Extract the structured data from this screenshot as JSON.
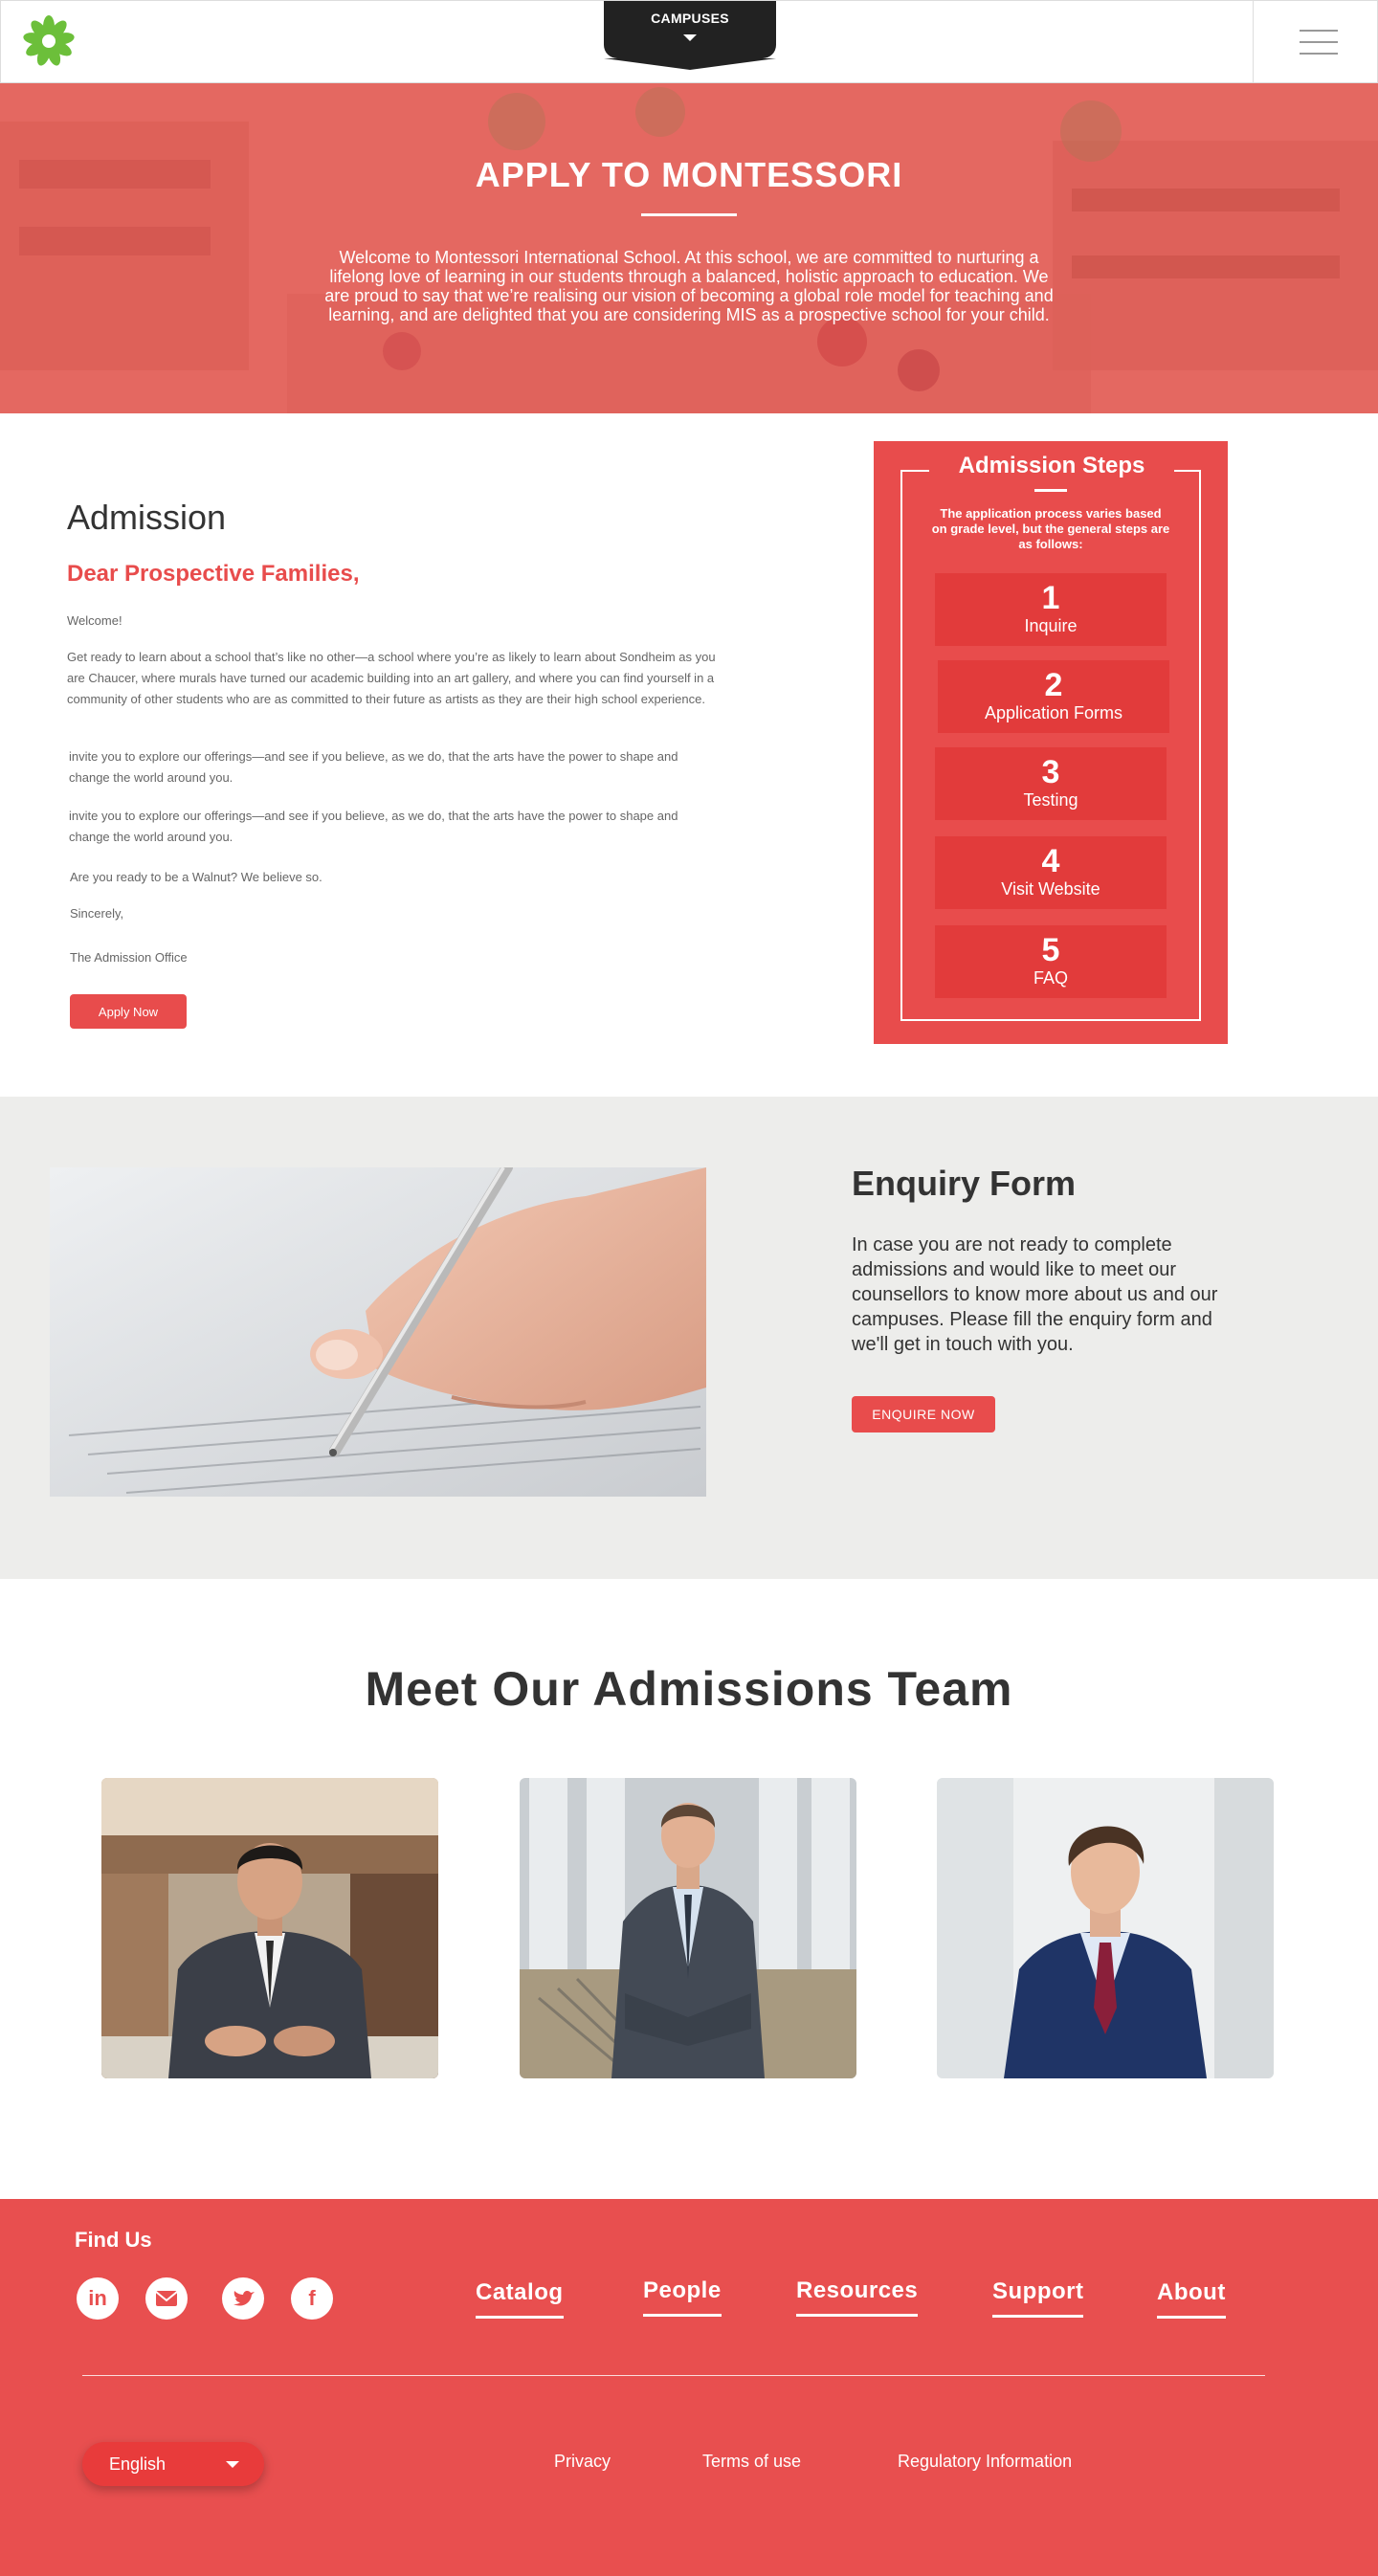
{
  "header": {
    "campus_label": "CAMPUSES",
    "logo_icon": "flower-logo-icon",
    "menu_icon": "hamburger-menu-icon"
  },
  "hero": {
    "title": "APPLY TO MONTESSORI",
    "text": "Welcome to Montessori International School. At this school, we are committed to nurturing a lifelong love of learning in our students through a balanced, holistic approach to education. We are proud to say that we’re realising our vision of becoming a global role model for teaching and learning, and are delighted that you are considering MIS as a prospective school for your child."
  },
  "admission": {
    "heading": "Admission",
    "greeting": "Dear Prospective Families,",
    "welcome": "Welcome!",
    "p1": "Get ready to learn about a school that’s like no other—a school where you’re as likely to learn about Sondheim as you are Chaucer, where murals have turned our academic building into an art gallery, and where you can find yourself in a community of other students who are as committed to their future as artists as they are their high school experience.",
    "p2": " invite you to explore our offerings—and see if you believe, as we do, that the arts have the power to shape and change the world around you.",
    "p3": " invite you to explore our offerings—and see if you believe, as we do, that the arts have the power to shape and change the world around you.",
    "p4": "Are you ready to be a Walnut? We believe so.",
    "p5": "Sincerely,",
    "p6": "The Admission Office",
    "apply_label": "Apply Now"
  },
  "steps": {
    "title": "Admission Steps",
    "intro": "The application process varies based on grade level, but the general steps are as follows:",
    "items": [
      {
        "num": "1",
        "label": "Inquire"
      },
      {
        "num": "2",
        "label": "Application Forms"
      },
      {
        "num": "3",
        "label": "Testing"
      },
      {
        "num": "4",
        "label": "Visit Website"
      },
      {
        "num": "5",
        "label": "FAQ"
      }
    ]
  },
  "enquiry": {
    "title": "Enquiry Form",
    "text": "In case you are not ready to complete admissions and would like to meet our counsellors to know more about us and our campuses. Please fill the enquiry form and we'll get in touch with you.",
    "button_label": "ENQUIRE NOW"
  },
  "team": {
    "title": "Meet Our Admissions Team"
  },
  "footer": {
    "find_us": "Find Us",
    "social": [
      "linkedin-icon",
      "email-icon",
      "twitter-icon",
      "facebook-icon"
    ],
    "nav": [
      "Catalog",
      "People",
      "Resources",
      "Support",
      "About"
    ],
    "language": "English",
    "links": [
      "Privacy",
      "Terms of use",
      "Regulatory Information"
    ]
  },
  "colors": {
    "accent": "#e84c4c",
    "enquiry_bg": "#ededeb",
    "footer_bg": "#e84f4f"
  }
}
